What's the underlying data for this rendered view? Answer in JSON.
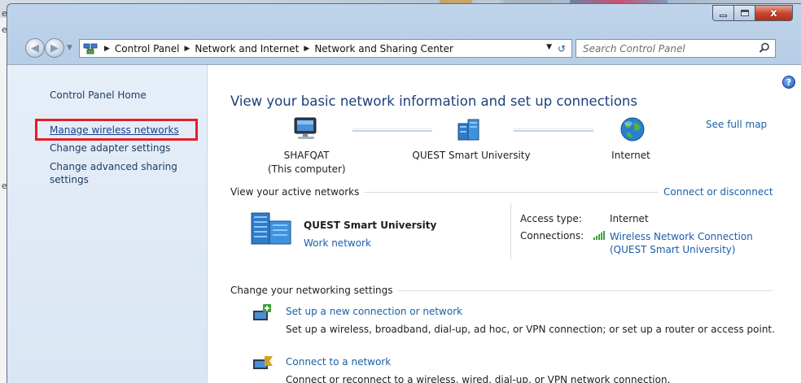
{
  "window": {
    "accent": "#1e3f7a",
    "link_color": "#1a5fa8",
    "highlight_color": "#e41e26"
  },
  "background": {
    "left_text_1": "e",
    "left_text_2": "e",
    "left_text_3": "e("
  },
  "caption": {
    "close_glyph": "x"
  },
  "address_bar": {
    "crumbs": [
      "Control Panel",
      "Network and Internet",
      "Network and Sharing Center"
    ],
    "search_placeholder": "Search Control Panel"
  },
  "sidebar": {
    "home_label": "Control Panel Home",
    "items": [
      {
        "label": "Manage wireless networks",
        "highlighted": true
      },
      {
        "label": "Change adapter settings"
      },
      {
        "label": "Change advanced sharing settings"
      }
    ]
  },
  "main": {
    "title": "View your basic network information and set up connections",
    "see_full_map": "See full map",
    "map": {
      "computer_name": "SHAFQAT",
      "computer_sub": "(This computer)",
      "network_name": "QUEST Smart University",
      "internet_label": "Internet"
    },
    "active_networks": {
      "header": "View your active networks",
      "connect_link": "Connect or disconnect",
      "network_name": "QUEST Smart University",
      "network_type": "Work network",
      "access_type_label": "Access type:",
      "access_type_value": "Internet",
      "connections_label": "Connections:",
      "connections_value_line1": "Wireless Network Connection",
      "connections_value_line2": "(QUEST Smart University)"
    },
    "change_settings": {
      "header": "Change your networking settings",
      "tasks": [
        {
          "link": "Set up a new connection or network",
          "description": "Set up a wireless, broadband, dial-up, ad hoc, or VPN connection; or set up a router or access point."
        },
        {
          "link": "Connect to a network",
          "description": "Connect or reconnect to a wireless, wired, dial-up, or VPN network connection."
        }
      ]
    }
  }
}
